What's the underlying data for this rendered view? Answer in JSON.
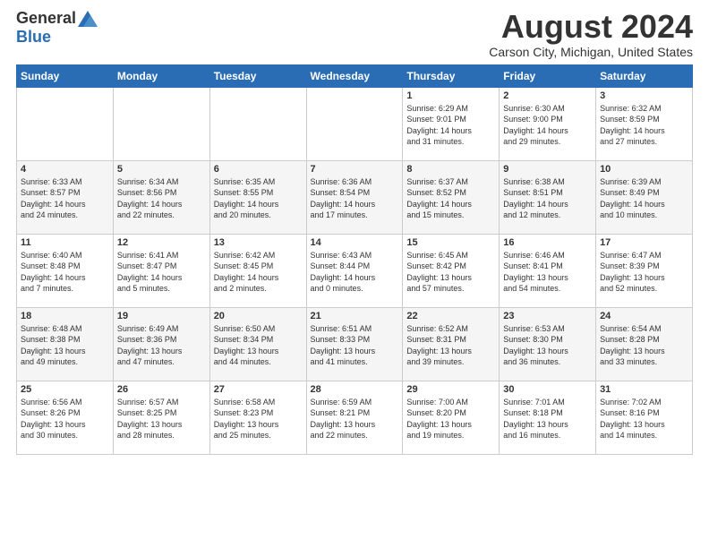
{
  "logo": {
    "general": "General",
    "blue": "Blue"
  },
  "title": "August 2024",
  "subtitle": "Carson City, Michigan, United States",
  "days_of_week": [
    "Sunday",
    "Monday",
    "Tuesday",
    "Wednesday",
    "Thursday",
    "Friday",
    "Saturday"
  ],
  "weeks": [
    [
      {
        "day": "",
        "info": ""
      },
      {
        "day": "",
        "info": ""
      },
      {
        "day": "",
        "info": ""
      },
      {
        "day": "",
        "info": ""
      },
      {
        "day": "1",
        "info": "Sunrise: 6:29 AM\nSunset: 9:01 PM\nDaylight: 14 hours\nand 31 minutes."
      },
      {
        "day": "2",
        "info": "Sunrise: 6:30 AM\nSunset: 9:00 PM\nDaylight: 14 hours\nand 29 minutes."
      },
      {
        "day": "3",
        "info": "Sunrise: 6:32 AM\nSunset: 8:59 PM\nDaylight: 14 hours\nand 27 minutes."
      }
    ],
    [
      {
        "day": "4",
        "info": "Sunrise: 6:33 AM\nSunset: 8:57 PM\nDaylight: 14 hours\nand 24 minutes."
      },
      {
        "day": "5",
        "info": "Sunrise: 6:34 AM\nSunset: 8:56 PM\nDaylight: 14 hours\nand 22 minutes."
      },
      {
        "day": "6",
        "info": "Sunrise: 6:35 AM\nSunset: 8:55 PM\nDaylight: 14 hours\nand 20 minutes."
      },
      {
        "day": "7",
        "info": "Sunrise: 6:36 AM\nSunset: 8:54 PM\nDaylight: 14 hours\nand 17 minutes."
      },
      {
        "day": "8",
        "info": "Sunrise: 6:37 AM\nSunset: 8:52 PM\nDaylight: 14 hours\nand 15 minutes."
      },
      {
        "day": "9",
        "info": "Sunrise: 6:38 AM\nSunset: 8:51 PM\nDaylight: 14 hours\nand 12 minutes."
      },
      {
        "day": "10",
        "info": "Sunrise: 6:39 AM\nSunset: 8:49 PM\nDaylight: 14 hours\nand 10 minutes."
      }
    ],
    [
      {
        "day": "11",
        "info": "Sunrise: 6:40 AM\nSunset: 8:48 PM\nDaylight: 14 hours\nand 7 minutes."
      },
      {
        "day": "12",
        "info": "Sunrise: 6:41 AM\nSunset: 8:47 PM\nDaylight: 14 hours\nand 5 minutes."
      },
      {
        "day": "13",
        "info": "Sunrise: 6:42 AM\nSunset: 8:45 PM\nDaylight: 14 hours\nand 2 minutes."
      },
      {
        "day": "14",
        "info": "Sunrise: 6:43 AM\nSunset: 8:44 PM\nDaylight: 14 hours\nand 0 minutes."
      },
      {
        "day": "15",
        "info": "Sunrise: 6:45 AM\nSunset: 8:42 PM\nDaylight: 13 hours\nand 57 minutes."
      },
      {
        "day": "16",
        "info": "Sunrise: 6:46 AM\nSunset: 8:41 PM\nDaylight: 13 hours\nand 54 minutes."
      },
      {
        "day": "17",
        "info": "Sunrise: 6:47 AM\nSunset: 8:39 PM\nDaylight: 13 hours\nand 52 minutes."
      }
    ],
    [
      {
        "day": "18",
        "info": "Sunrise: 6:48 AM\nSunset: 8:38 PM\nDaylight: 13 hours\nand 49 minutes."
      },
      {
        "day": "19",
        "info": "Sunrise: 6:49 AM\nSunset: 8:36 PM\nDaylight: 13 hours\nand 47 minutes."
      },
      {
        "day": "20",
        "info": "Sunrise: 6:50 AM\nSunset: 8:34 PM\nDaylight: 13 hours\nand 44 minutes."
      },
      {
        "day": "21",
        "info": "Sunrise: 6:51 AM\nSunset: 8:33 PM\nDaylight: 13 hours\nand 41 minutes."
      },
      {
        "day": "22",
        "info": "Sunrise: 6:52 AM\nSunset: 8:31 PM\nDaylight: 13 hours\nand 39 minutes."
      },
      {
        "day": "23",
        "info": "Sunrise: 6:53 AM\nSunset: 8:30 PM\nDaylight: 13 hours\nand 36 minutes."
      },
      {
        "day": "24",
        "info": "Sunrise: 6:54 AM\nSunset: 8:28 PM\nDaylight: 13 hours\nand 33 minutes."
      }
    ],
    [
      {
        "day": "25",
        "info": "Sunrise: 6:56 AM\nSunset: 8:26 PM\nDaylight: 13 hours\nand 30 minutes."
      },
      {
        "day": "26",
        "info": "Sunrise: 6:57 AM\nSunset: 8:25 PM\nDaylight: 13 hours\nand 28 minutes."
      },
      {
        "day": "27",
        "info": "Sunrise: 6:58 AM\nSunset: 8:23 PM\nDaylight: 13 hours\nand 25 minutes."
      },
      {
        "day": "28",
        "info": "Sunrise: 6:59 AM\nSunset: 8:21 PM\nDaylight: 13 hours\nand 22 minutes."
      },
      {
        "day": "29",
        "info": "Sunrise: 7:00 AM\nSunset: 8:20 PM\nDaylight: 13 hours\nand 19 minutes."
      },
      {
        "day": "30",
        "info": "Sunrise: 7:01 AM\nSunset: 8:18 PM\nDaylight: 13 hours\nand 16 minutes."
      },
      {
        "day": "31",
        "info": "Sunrise: 7:02 AM\nSunset: 8:16 PM\nDaylight: 13 hours\nand 14 minutes."
      }
    ]
  ]
}
